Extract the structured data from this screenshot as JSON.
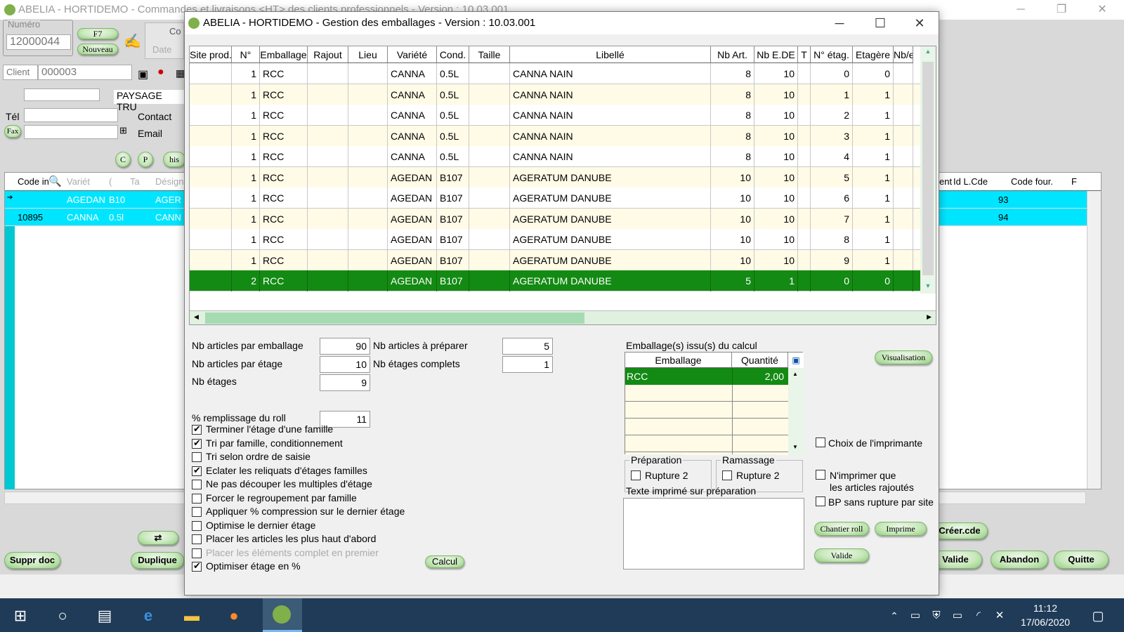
{
  "bg_app": {
    "title": "ABELIA   -   HORTIDEMO   -   Commandes et livraisons <HT> des clients professionnels   -   Version : 10.03.001",
    "numero_label": "Numéro",
    "numero_value": "12000044",
    "f7": "F7",
    "nouveau": "Nouveau",
    "co": "Co",
    "date": "Date",
    "client_label": "Client",
    "client_value": "000003",
    "client_name": "PAYSAGE TRU",
    "tel": "Tél",
    "contact": "Contact",
    "fax": "Fax",
    "email": "Email",
    "his": "his",
    "c_btn": "C",
    "p_btn": "P",
    "headers": [
      "Code in",
      "Variét",
      "(",
      "Ta",
      "Désign"
    ],
    "right_headers": [
      "ent",
      "Id L.Cde",
      "Code four.",
      "F"
    ],
    "rows": [
      {
        "code": "",
        "variete": "AGEDAN",
        "cond": "B10",
        "taille": "",
        "design": "AGER",
        "id": "93"
      },
      {
        "code": "10895",
        "variete": "CANNA",
        "cond": "0.5l",
        "taille": "",
        "design": "CANN",
        "id": "94"
      }
    ],
    "buttons": {
      "suppr": "Suppr doc",
      "duplique": "Duplique",
      "creer": "Créer.cde",
      "valide": "Valide",
      "abandon": "Abandon",
      "quitte": "Quitte"
    }
  },
  "dialog": {
    "title": "ABELIA   -   HORTIDEMO   -   Gestion des emballages   -   Version : 10.03.001",
    "columns": [
      "Site prod.",
      "N°",
      "Emballage",
      "Rajout",
      "Lieu",
      "Variété",
      "Cond.",
      "Taille",
      "Libellé",
      "Nb Art.",
      "Nb E.DE",
      "T",
      "N° étag.",
      "Etagère",
      "Nb/e"
    ],
    "rows": [
      {
        "site": "",
        "n": "1",
        "emb": "RCC",
        "rajout": "",
        "lieu": "",
        "var": "CANNA",
        "cond": "0.5L",
        "taille": "",
        "lib": "CANNA NAIN",
        "nbart": "8",
        "nbede": "10",
        "t": "",
        "netag": "0",
        "etag": "0",
        "nbe": ""
      },
      {
        "site": "",
        "n": "1",
        "emb": "RCC",
        "rajout": "",
        "lieu": "",
        "var": "CANNA",
        "cond": "0.5L",
        "taille": "",
        "lib": "CANNA NAIN",
        "nbart": "8",
        "nbede": "10",
        "t": "",
        "netag": "1",
        "etag": "1",
        "nbe": ""
      },
      {
        "site": "",
        "n": "1",
        "emb": "RCC",
        "rajout": "",
        "lieu": "",
        "var": "CANNA",
        "cond": "0.5L",
        "taille": "",
        "lib": "CANNA NAIN",
        "nbart": "8",
        "nbede": "10",
        "t": "",
        "netag": "2",
        "etag": "1",
        "nbe": ""
      },
      {
        "site": "",
        "n": "1",
        "emb": "RCC",
        "rajout": "",
        "lieu": "",
        "var": "CANNA",
        "cond": "0.5L",
        "taille": "",
        "lib": "CANNA NAIN",
        "nbart": "8",
        "nbede": "10",
        "t": "",
        "netag": "3",
        "etag": "1",
        "nbe": ""
      },
      {
        "site": "",
        "n": "1",
        "emb": "RCC",
        "rajout": "",
        "lieu": "",
        "var": "CANNA",
        "cond": "0.5L",
        "taille": "",
        "lib": "CANNA NAIN",
        "nbart": "8",
        "nbede": "10",
        "t": "",
        "netag": "4",
        "etag": "1",
        "nbe": ""
      },
      {
        "site": "",
        "n": "1",
        "emb": "RCC",
        "rajout": "",
        "lieu": "",
        "var": "AGEDAN",
        "cond": "B107",
        "taille": "",
        "lib": "AGERATUM DANUBE",
        "nbart": "10",
        "nbede": "10",
        "t": "",
        "netag": "5",
        "etag": "1",
        "nbe": ""
      },
      {
        "site": "",
        "n": "1",
        "emb": "RCC",
        "rajout": "",
        "lieu": "",
        "var": "AGEDAN",
        "cond": "B107",
        "taille": "",
        "lib": "AGERATUM DANUBE",
        "nbart": "10",
        "nbede": "10",
        "t": "",
        "netag": "6",
        "etag": "1",
        "nbe": ""
      },
      {
        "site": "",
        "n": "1",
        "emb": "RCC",
        "rajout": "",
        "lieu": "",
        "var": "AGEDAN",
        "cond": "B107",
        "taille": "",
        "lib": "AGERATUM DANUBE",
        "nbart": "10",
        "nbede": "10",
        "t": "",
        "netag": "7",
        "etag": "1",
        "nbe": ""
      },
      {
        "site": "",
        "n": "1",
        "emb": "RCC",
        "rajout": "",
        "lieu": "",
        "var": "AGEDAN",
        "cond": "B107",
        "taille": "",
        "lib": "AGERATUM DANUBE",
        "nbart": "10",
        "nbede": "10",
        "t": "",
        "netag": "8",
        "etag": "1",
        "nbe": ""
      },
      {
        "site": "",
        "n": "1",
        "emb": "RCC",
        "rajout": "",
        "lieu": "",
        "var": "AGEDAN",
        "cond": "B107",
        "taille": "",
        "lib": "AGERATUM DANUBE",
        "nbart": "10",
        "nbede": "10",
        "t": "",
        "netag": "9",
        "etag": "1",
        "nbe": ""
      },
      {
        "site": "",
        "n": "2",
        "emb": "RCC",
        "rajout": "",
        "lieu": "",
        "var": "AGEDAN",
        "cond": "B107",
        "taille": "",
        "lib": "AGERATUM DANUBE",
        "nbart": "5",
        "nbede": "1",
        "t": "",
        "netag": "0",
        "etag": "0",
        "nbe": ""
      }
    ],
    "selected_row": 10,
    "fields": {
      "nb_art_emb_label": "Nb articles par emballage",
      "nb_art_emb": "90",
      "nb_art_etage_label": "Nb articles par étage",
      "nb_art_etage": "10",
      "nb_etages_label": "Nb étages",
      "nb_etages": "9",
      "pct_roll_label": "% remplissage du roll",
      "pct_roll": "11",
      "nb_prep_label": "Nb articles à préparer",
      "nb_prep": "5",
      "nb_etages_complets_label": "Nb étages complets",
      "nb_etages_complets": "1"
    },
    "options": [
      {
        "label": "Terminer l'étage d'une famille",
        "checked": true
      },
      {
        "label": "Tri par famille, conditionnement",
        "checked": true
      },
      {
        "label": "Tri selon ordre de saisie",
        "checked": false
      },
      {
        "label": "Eclater les reliquats d'étages familles",
        "checked": true
      },
      {
        "label": "Ne pas découper les multiples d'étage",
        "checked": false
      },
      {
        "label": "Forcer le regroupement par famille",
        "checked": false
      },
      {
        "label": "Appliquer % compression sur le dernier étage",
        "checked": false
      },
      {
        "label": "Optimise le dernier étage",
        "checked": false
      },
      {
        "label": "Placer les articles les plus haut d'abord",
        "checked": false
      },
      {
        "label": "Placer les éléments complet en premier",
        "checked": false,
        "disabled": true
      },
      {
        "label": "Optimiser étage en %",
        "checked": true
      }
    ],
    "calcul": "Calcul",
    "emb_calc_title": "Emballage(s) issu(s) du calcul",
    "emb_calc_headers": [
      "Emballage",
      "Quantité"
    ],
    "emb_calc_rows": [
      {
        "emb": "RCC",
        "qty": "2,00"
      }
    ],
    "visualisation": "Visualisation",
    "preparation_title": "Préparation",
    "ramassage_title": "Ramassage",
    "rupture2a": "Rupture 2",
    "rupture2b": "Rupture 2",
    "texte_label": "Texte imprimé sur préparation",
    "choix_imprimante": "Choix de l'imprimante",
    "nimprimer_line1": "N'imprimer que",
    "nimprimer_line2": "les articles rajoutés",
    "bp_sans": "BP sans rupture par site",
    "chantier": "Chantier roll",
    "imprime": "Imprime",
    "valide": "Valide"
  },
  "taskbar": {
    "time": "11:12",
    "date": "17/06/2020"
  }
}
